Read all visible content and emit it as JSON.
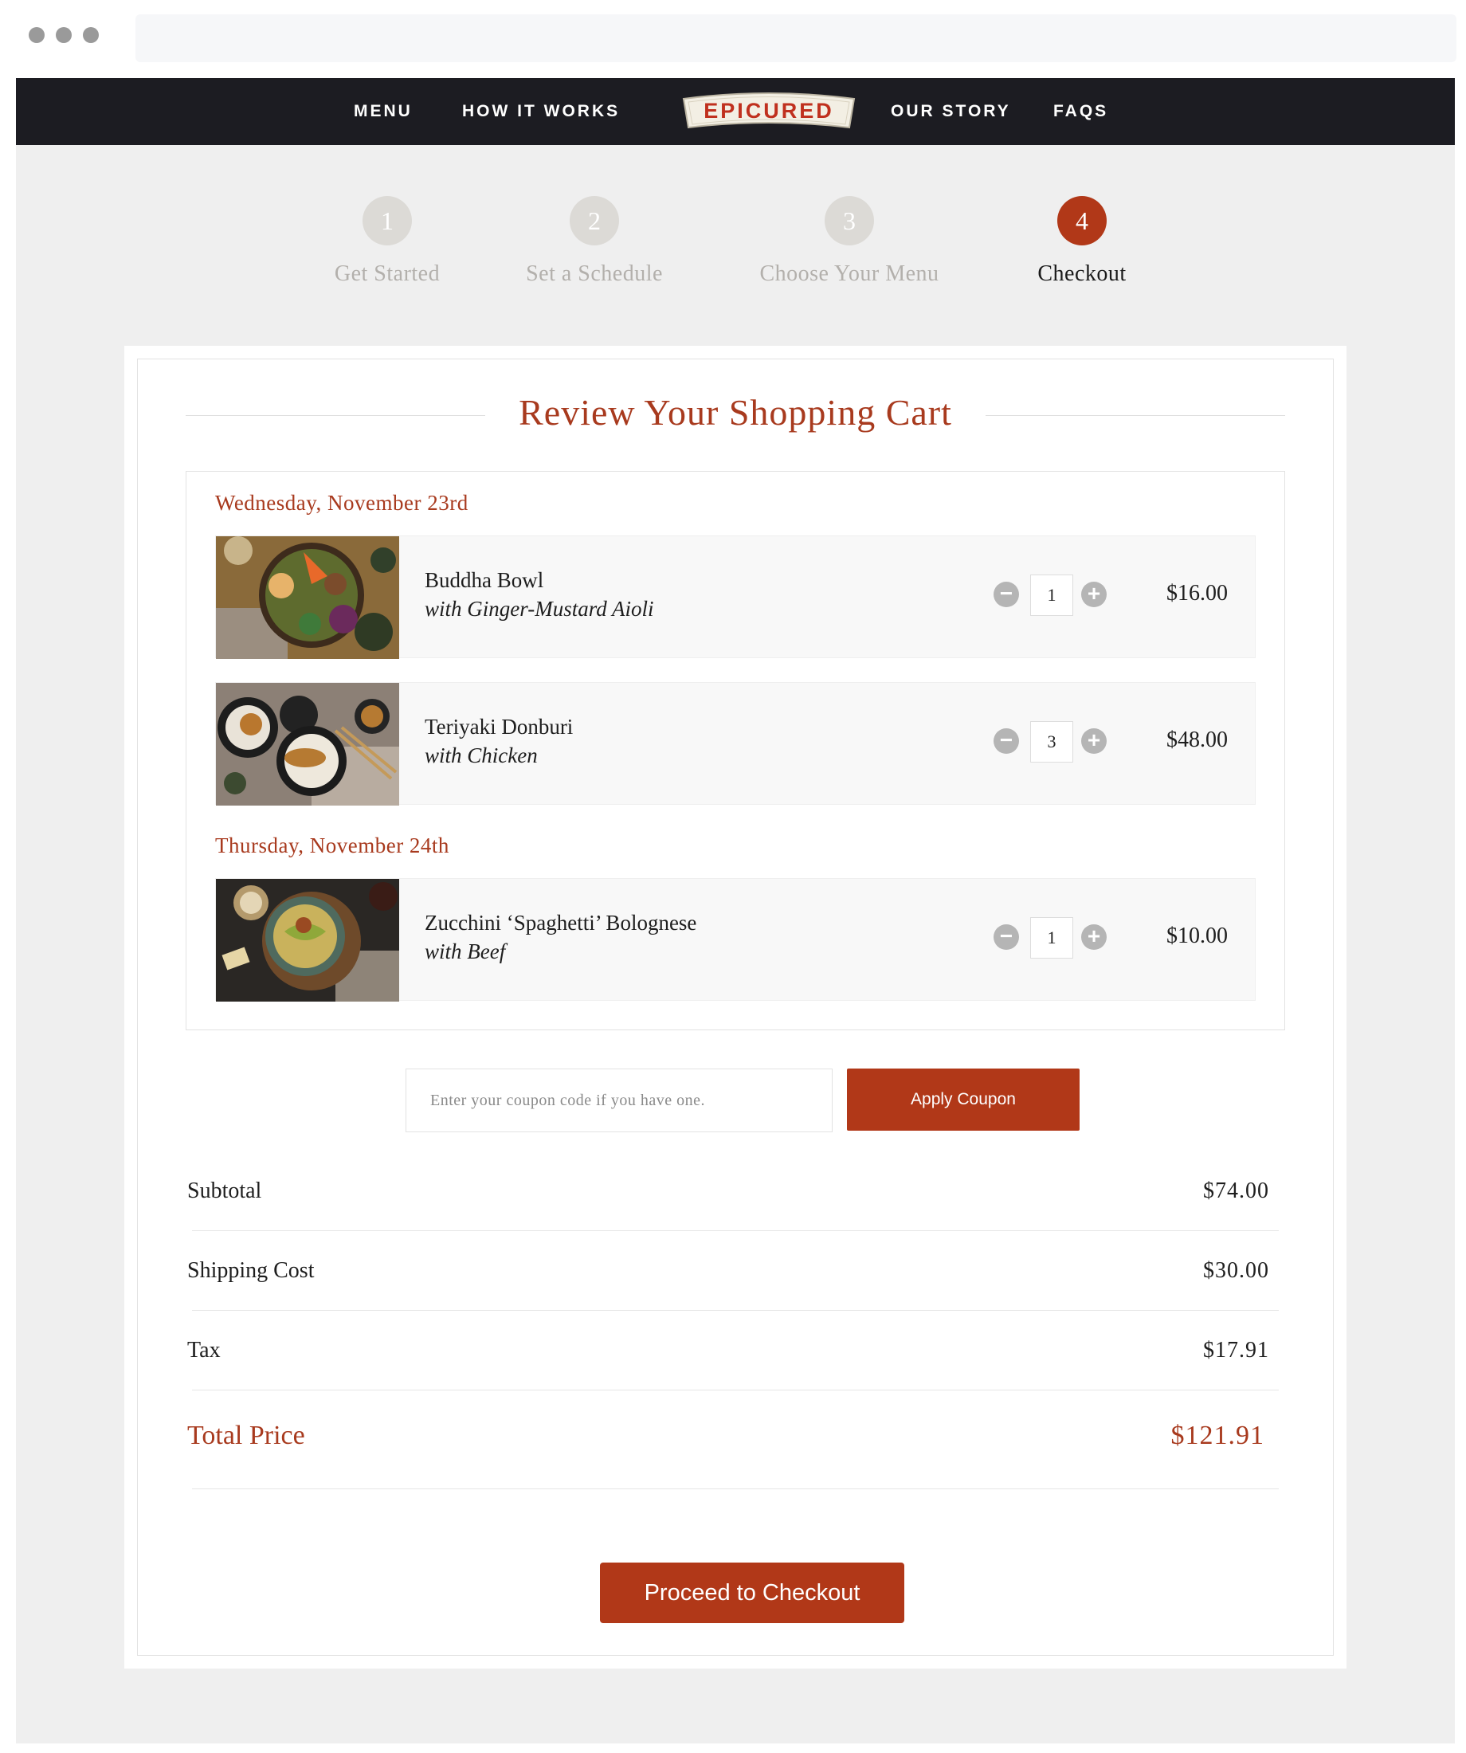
{
  "nav": {
    "links": [
      "MENU",
      "HOW IT WORKS",
      "OUR STORY",
      "FAQS"
    ],
    "logo_text": "EPICURED"
  },
  "steps": [
    {
      "number": "1",
      "label": "Get Started",
      "active": false
    },
    {
      "number": "2",
      "label": "Set a Schedule",
      "active": false
    },
    {
      "number": "3",
      "label": "Choose Your Menu",
      "active": false
    },
    {
      "number": "4",
      "label": "Checkout",
      "active": true
    }
  ],
  "cart": {
    "title": "Review Your Shopping Cart",
    "days": [
      {
        "label": "Wednesday, November 23rd",
        "items": [
          {
            "name": "Buddha Bowl",
            "sub": "with Ginger-Mustard Aioli",
            "qty": "1",
            "price": "$16.00",
            "image": "buddha-bowl-photo"
          },
          {
            "name": "Teriyaki Donburi",
            "sub": "with Chicken",
            "qty": "3",
            "price": "$48.00",
            "image": "teriyaki-donburi-photo"
          }
        ]
      },
      {
        "label": "Thursday, November 24th",
        "items": [
          {
            "name": "Zucchini ‘Spaghetti’ Bolognese",
            "sub": "with Beef",
            "qty": "1",
            "price": "$10.00",
            "image": "zucchini-bolognese-photo"
          }
        ]
      }
    ]
  },
  "coupon": {
    "placeholder": "Enter your coupon code if you have one.",
    "button_label": "Apply Coupon"
  },
  "totals": {
    "subtotal_label": "Subtotal",
    "subtotal": "$74.00",
    "shipping_label": "Shipping Cost",
    "shipping": "$30.00",
    "tax_label": "Tax",
    "tax": "$17.91",
    "total_label": "Total Price",
    "total": "$121.91"
  },
  "checkout_button": "Proceed to Checkout",
  "colors": {
    "accent": "#b13818",
    "accent_text": "#a83a1e",
    "nav_bg": "#1c1c22",
    "page_bg": "#efefef",
    "step_inactive": "#dcdad6"
  }
}
